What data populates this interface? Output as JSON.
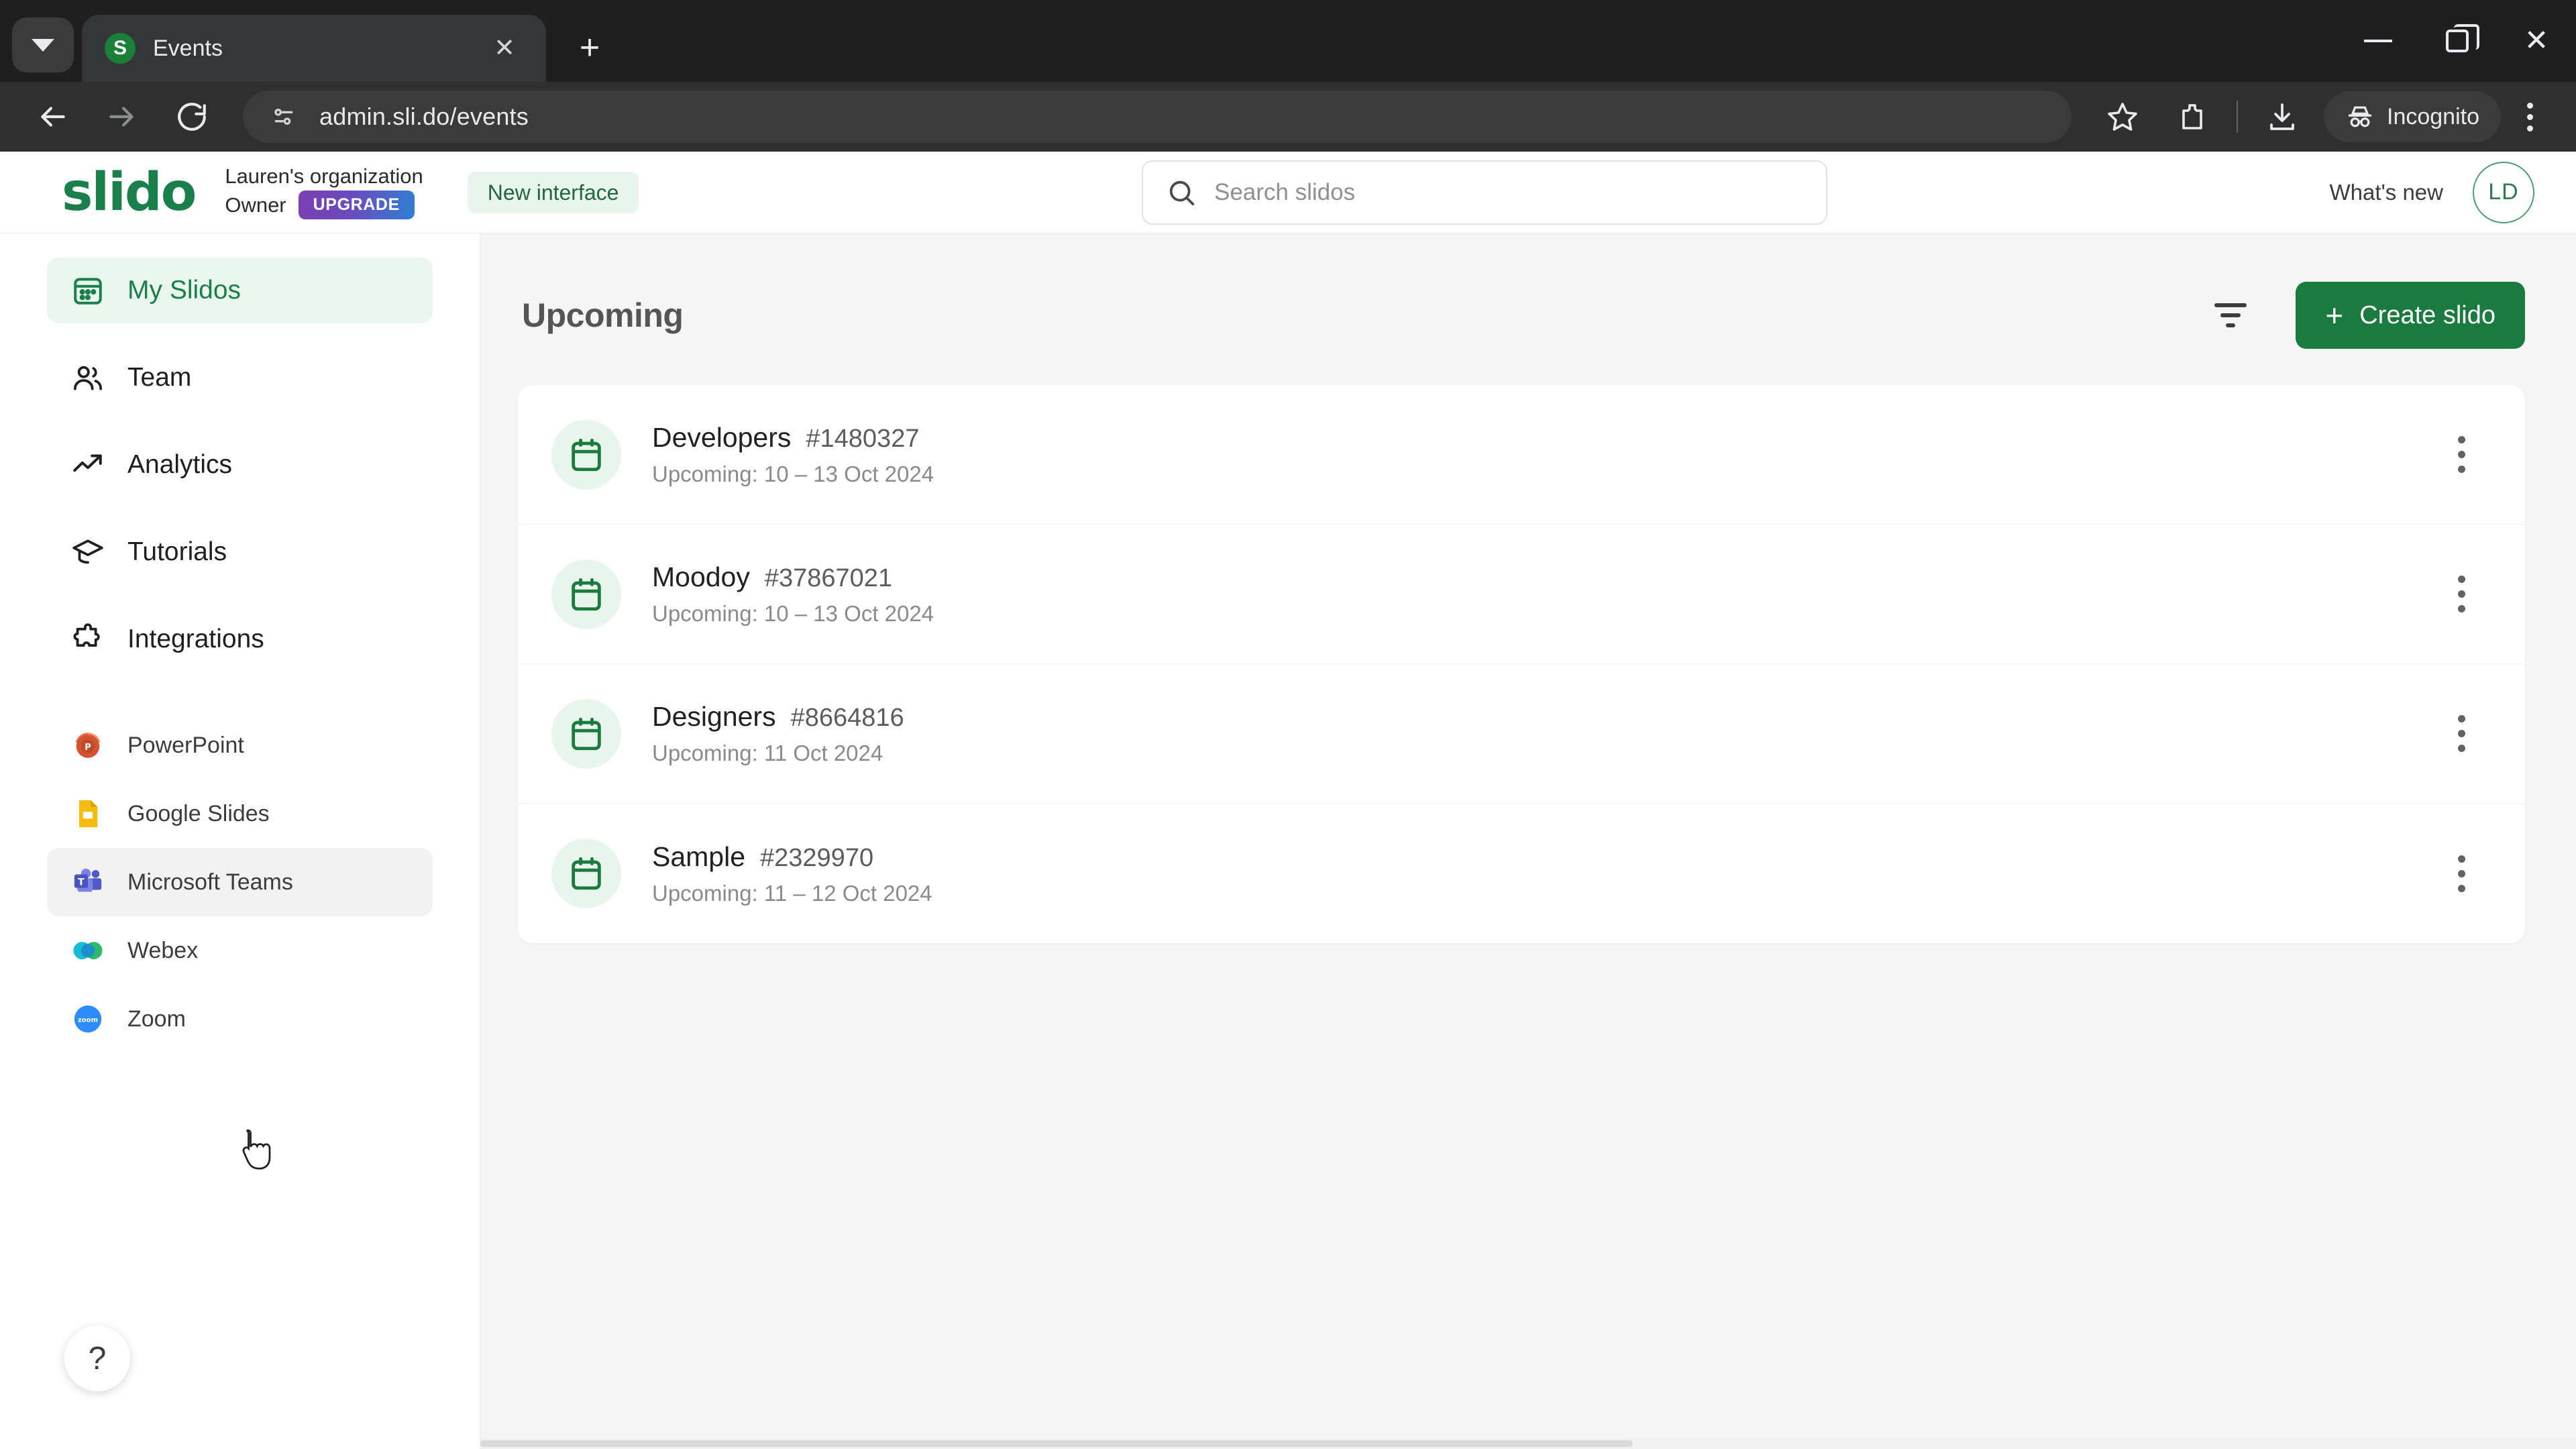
{
  "browser": {
    "tab": {
      "title": "Events",
      "favicon_letter": "S",
      "favicon_name": "slido-favicon"
    },
    "tab_list_icon": "chevron-down-icon",
    "new_tab_icon": "plus-icon",
    "close_tab_icon": "close-icon",
    "window": {
      "minimize": "minimize-icon",
      "maximize": "maximize-icon",
      "close": "close-icon"
    },
    "nav": {
      "back": "back-arrow-icon",
      "forward": "forward-arrow-icon",
      "reload": "reload-icon"
    },
    "omnibox": {
      "site_info_icon": "site-settings-icon",
      "url": "admin.sli.do/events"
    },
    "actions": {
      "bookmark": "star-icon",
      "extensions": "extensions-icon",
      "downloads": "download-icon",
      "profile_label": "Incognito",
      "profile_icon": "incognito-icon",
      "menu": "three-dot-menu-icon"
    }
  },
  "app": {
    "logo_text": "slido",
    "org_name": "Lauren's organization",
    "org_role": "Owner",
    "upgrade_label": "UPGRADE",
    "new_interface_label": "New interface",
    "search": {
      "placeholder": "Search slidos",
      "value": "",
      "icon": "search-icon"
    },
    "whats_new_label": "What's new",
    "avatar_initials": "LD"
  },
  "sidebar": {
    "items": [
      {
        "label": "My Slidos",
        "icon": "calendar-grid-icon",
        "active": true
      },
      {
        "label": "Team",
        "icon": "people-icon",
        "active": false
      },
      {
        "label": "Analytics",
        "icon": "trending-up-icon",
        "active": false
      },
      {
        "label": "Tutorials",
        "icon": "graduation-cap-icon",
        "active": false
      },
      {
        "label": "Integrations",
        "icon": "puzzle-piece-icon",
        "active": false
      }
    ],
    "integrations": [
      {
        "label": "PowerPoint",
        "icon": "powerpoint-icon",
        "hovered": false
      },
      {
        "label": "Google Slides",
        "icon": "google-slides-icon",
        "hovered": false
      },
      {
        "label": "Microsoft Teams",
        "icon": "microsoft-teams-icon",
        "hovered": true
      },
      {
        "label": "Webex",
        "icon": "webex-icon",
        "hovered": false
      },
      {
        "label": "Zoom",
        "icon": "zoom-icon",
        "hovered": false
      }
    ],
    "help_label": "?"
  },
  "main": {
    "title": "Upcoming",
    "filter_icon": "filter-icon",
    "create_button": {
      "label": "Create slido",
      "plus": "+",
      "icon": "plus-icon"
    },
    "events": [
      {
        "name": "Developers",
        "code": "#1480327",
        "schedule": "Upcoming: 10 – 13 Oct 2024"
      },
      {
        "name": "Moodoy",
        "code": "#37867021",
        "schedule": "Upcoming: 10 – 13 Oct 2024"
      },
      {
        "name": "Designers",
        "code": "#8664816",
        "schedule": "Upcoming: 11 Oct 2024"
      },
      {
        "name": "Sample",
        "code": "#2329970",
        "schedule": "Upcoming: 11 – 12 Oct 2024"
      }
    ],
    "row_menu_icon": "three-dot-menu-icon"
  },
  "colors": {
    "brand_green": "#1a7f4b",
    "create_button_green": "#1b7a3e",
    "active_nav_bg": "#e9f5ed",
    "page_bg": "#f5f5f5",
    "chrome_dark": "#2f2f2f"
  }
}
